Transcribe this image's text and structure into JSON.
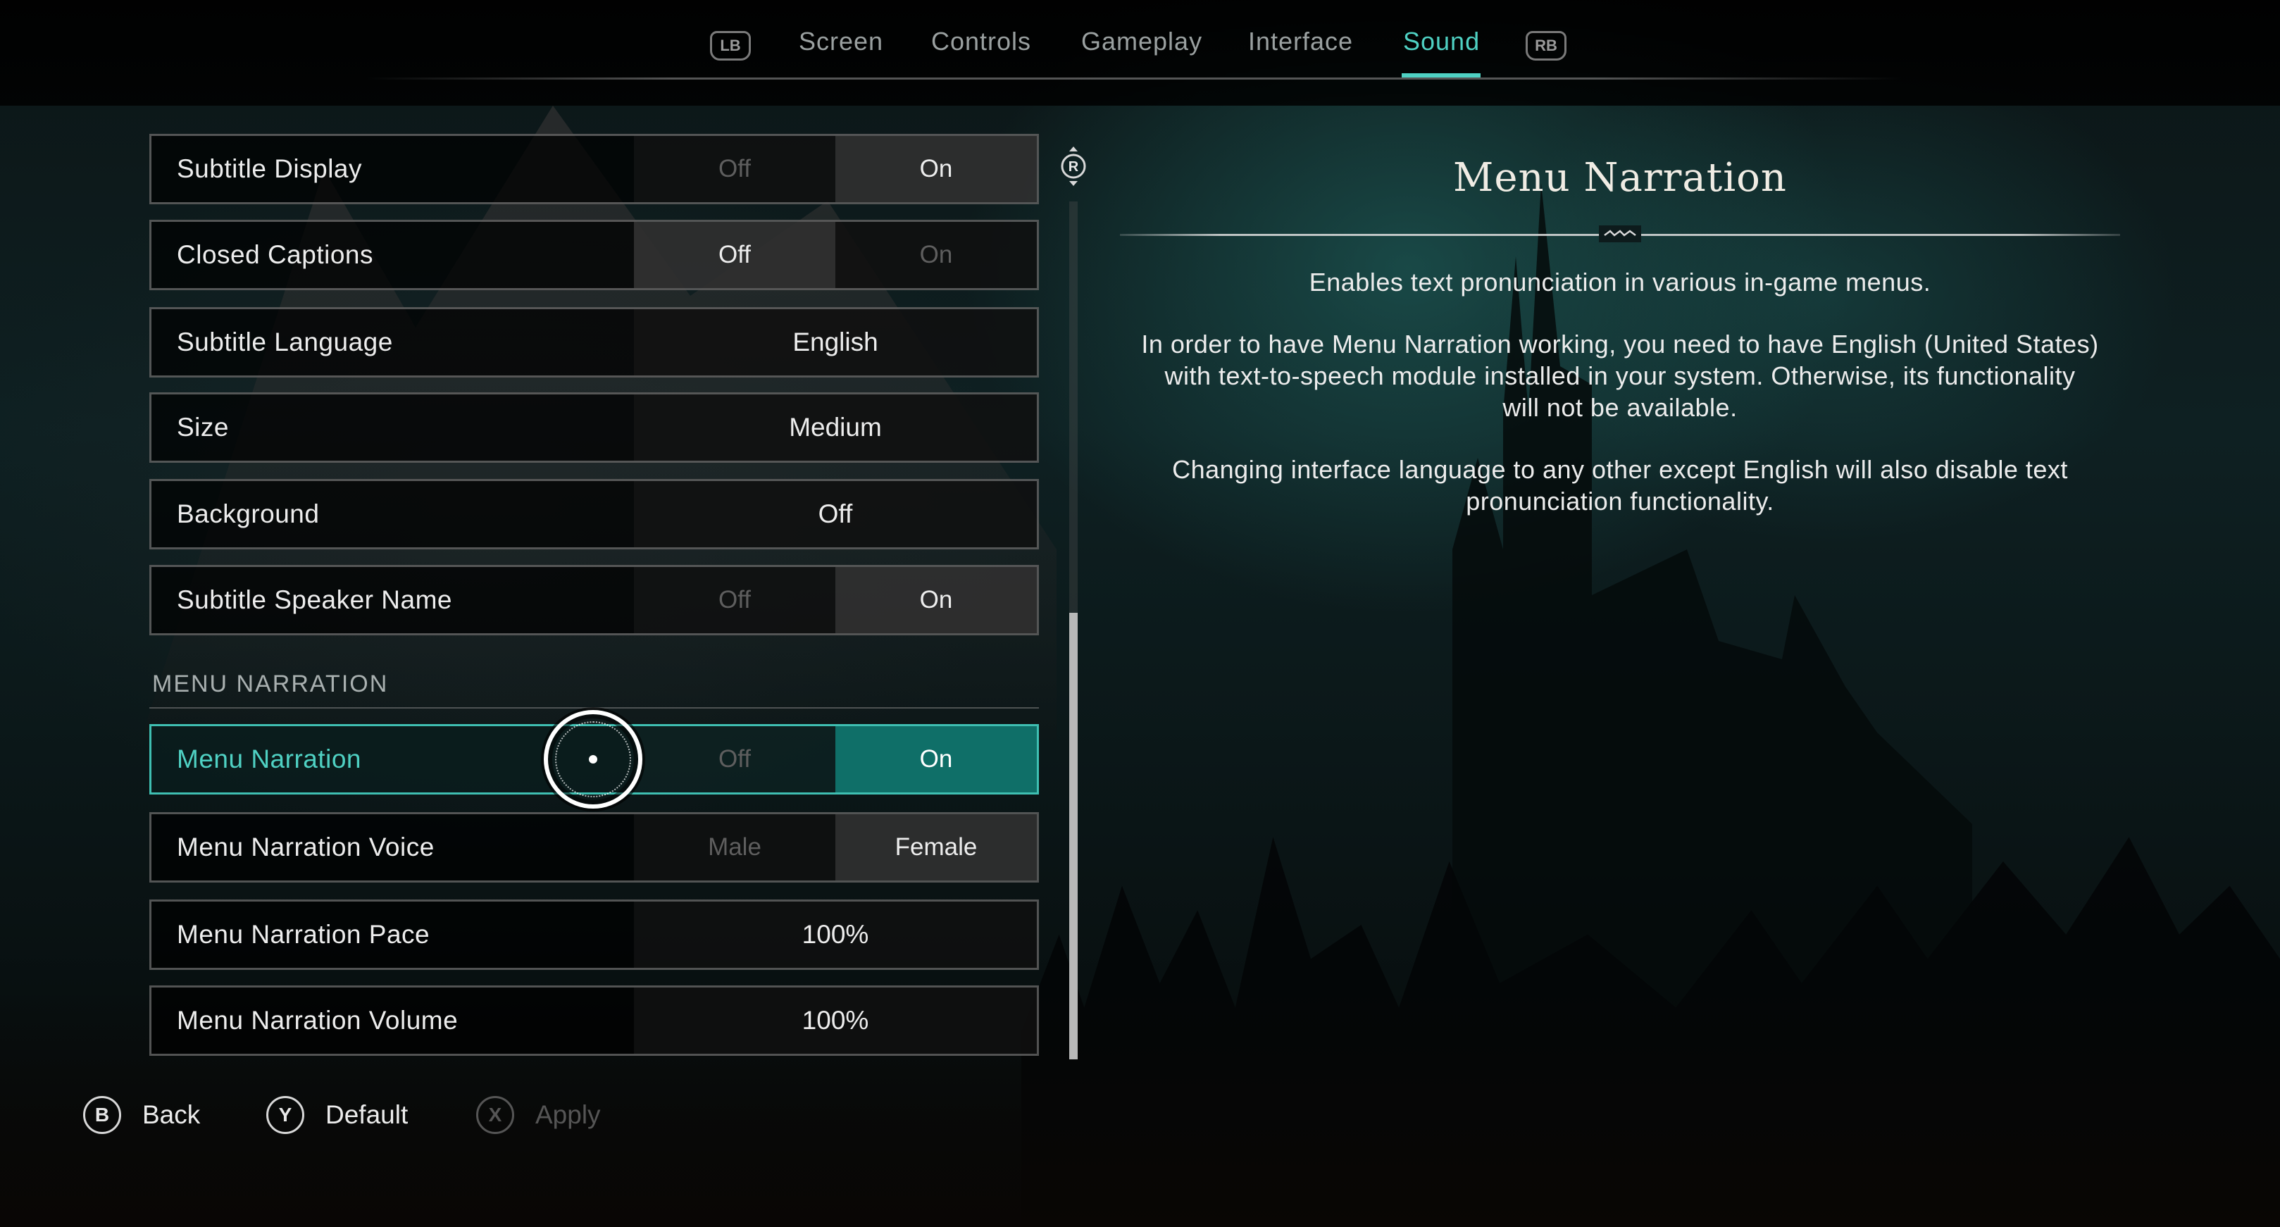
{
  "tabs": {
    "left_bumper": "LB",
    "right_bumper": "RB",
    "items": [
      {
        "label": "Screen"
      },
      {
        "label": "Controls"
      },
      {
        "label": "Gameplay"
      },
      {
        "label": "Interface"
      },
      {
        "label": "Sound"
      }
    ],
    "active": "Sound"
  },
  "settings": {
    "subtitle_display": {
      "label": "Subtitle Display",
      "options": [
        "Off",
        "On"
      ],
      "selected": "On"
    },
    "closed_captions": {
      "label": "Closed Captions",
      "options": [
        "Off",
        "On"
      ],
      "selected": "Off"
    },
    "subtitle_language": {
      "label": "Subtitle Language",
      "value": "English"
    },
    "size": {
      "label": "Size",
      "value": "Medium"
    },
    "background": {
      "label": "Background",
      "value": "Off"
    },
    "subtitle_speaker_name": {
      "label": "Subtitle Speaker Name",
      "options": [
        "Off",
        "On"
      ],
      "selected": "On"
    },
    "section_menu_narration": "MENU NARRATION",
    "menu_narration": {
      "label": "Menu Narration",
      "options": [
        "Off",
        "On"
      ],
      "selected": "On",
      "focused": true
    },
    "menu_narration_voice": {
      "label": "Menu Narration Voice",
      "options": [
        "Male",
        "Female"
      ],
      "selected": "Female"
    },
    "menu_narration_pace": {
      "label": "Menu Narration Pace",
      "value": "100%"
    },
    "menu_narration_volume": {
      "label": "Menu Narration Volume",
      "value": "100%"
    }
  },
  "scroll_stick": "R",
  "description": {
    "title": "Menu Narration",
    "paragraph_1": "Enables text pronunciation in various in-game menus.",
    "paragraph_2_line_1": "In order to have Menu Narration working, you need to have English (United States)",
    "paragraph_2_line_2": "with text-to-speech module installed in your system. Otherwise, its functionality",
    "paragraph_2_line_3": "will not be available.",
    "paragraph_3_line_1": "Changing interface language to any other except English will also disable text",
    "paragraph_3_line_2": "pronunciation functionality."
  },
  "footer": {
    "back": {
      "button": "B",
      "label": "Back"
    },
    "default": {
      "button": "Y",
      "label": "Default"
    },
    "apply": {
      "button": "X",
      "label": "Apply",
      "disabled": true
    }
  },
  "colors": {
    "accent": "#4fd1c3",
    "focus_fill": "#0f6f68"
  }
}
